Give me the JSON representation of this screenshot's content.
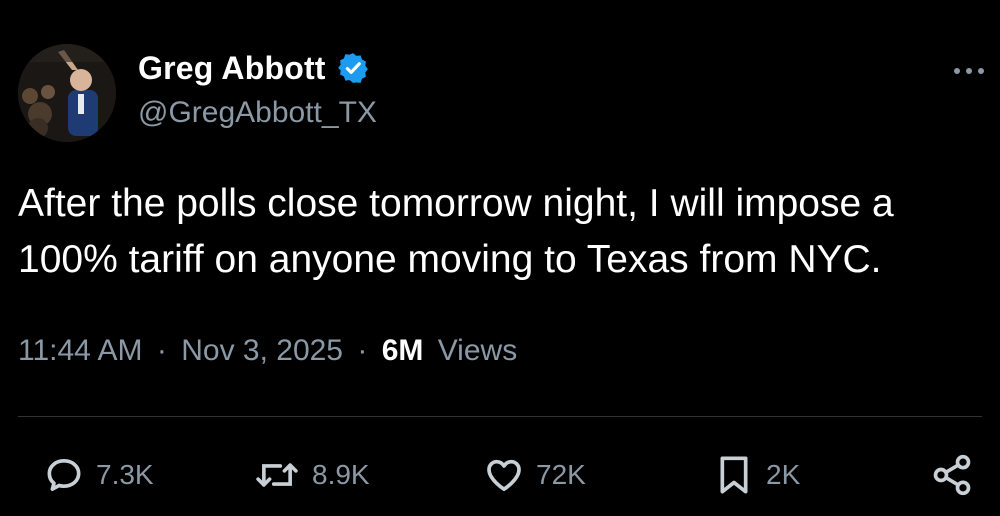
{
  "author": {
    "display_name": "Greg Abbott",
    "handle": "@GregAbbott_TX",
    "verified_icon": "verified-badge-icon",
    "avatar_icon": "avatar-photo"
  },
  "tweet": {
    "text": "After the polls close tomorrow night, I will impose a 100% tariff on anyone moving to Texas from NYC.",
    "time": "11:44 AM",
    "separator": "·",
    "date": "Nov 3, 2025",
    "views_count": "6M",
    "views_label": "Views"
  },
  "actions": {
    "reply": "7.3K",
    "repost": "8.9K",
    "like": "72K",
    "bookmark": "2K"
  },
  "more_icon": "more-options-icon",
  "colors": {
    "background": "#000000",
    "primary_text": "#ffffff",
    "secondary_text": "#8b98a5",
    "verified": "#1d9bf0",
    "divider": "#2f3336"
  }
}
